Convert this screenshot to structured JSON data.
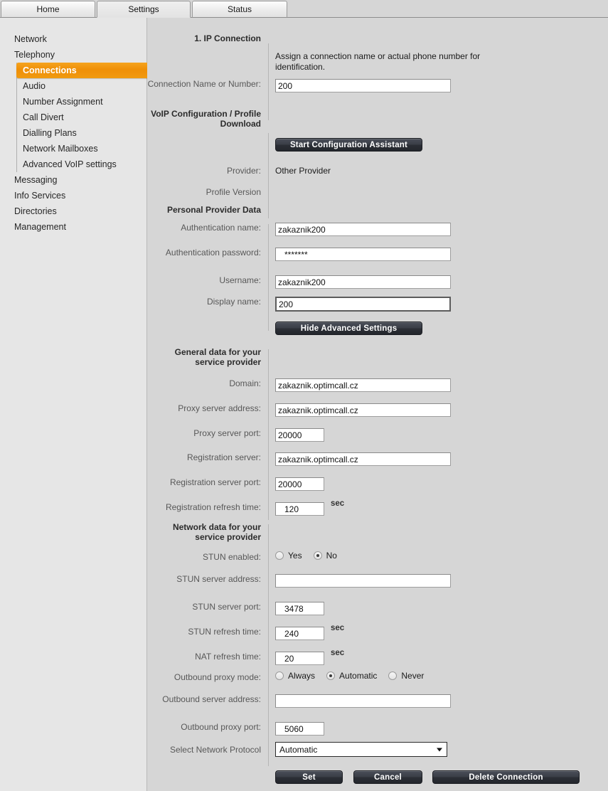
{
  "tabs": [
    {
      "label": "Home",
      "active": false
    },
    {
      "label": "Settings",
      "active": true
    },
    {
      "label": "Status",
      "active": false
    }
  ],
  "sidebar": {
    "items": [
      {
        "label": "Network"
      },
      {
        "label": "Telephony"
      },
      {
        "label": "Messaging"
      },
      {
        "label": "Info Services"
      },
      {
        "label": "Directories"
      },
      {
        "label": "Management"
      }
    ],
    "telephony_sub": [
      {
        "label": "Connections",
        "selected": true
      },
      {
        "label": "Audio",
        "selected": false
      },
      {
        "label": "Number Assignment",
        "selected": false
      },
      {
        "label": "Call Divert",
        "selected": false
      },
      {
        "label": "Dialling Plans",
        "selected": false
      },
      {
        "label": "Network Mailboxes",
        "selected": false
      },
      {
        "label": "Advanced VoIP settings",
        "selected": false
      }
    ]
  },
  "main": {
    "section_title": "1. IP Connection",
    "help_text": "Assign a connection name or actual phone number for identification.",
    "connection_name_label": "Connection Name or Number:",
    "connection_name_value": "200",
    "voip_config_label": "VoIP Configuration / Profile Download",
    "start_assistant_button": "Start Configuration Assistant",
    "provider_label": "Provider:",
    "provider_value": "Other Provider",
    "profile_version_label": "Profile Version",
    "profile_version_value": "",
    "personal_provider_data_label": "Personal Provider Data",
    "auth_name_label": "Authentication name:",
    "auth_name_value": "zakaznik200",
    "auth_password_label": "Authentication password:",
    "auth_password_value": "*******",
    "username_label": "Username:",
    "username_value": "zakaznik200",
    "display_name_label": "Display name:",
    "display_name_value": "200",
    "hide_advanced_button": "Hide Advanced Settings",
    "general_data_label": "General data for your service provider",
    "domain_label": "Domain:",
    "domain_value": "zakaznik.optimcall.cz",
    "proxy_server_address_label": "Proxy server address:",
    "proxy_server_address_value": "zakaznik.optimcall.cz",
    "proxy_server_port_label": "Proxy server port:",
    "proxy_server_port_value": "20000",
    "registration_server_label": "Registration server:",
    "registration_server_value": "zakaznik.optimcall.cz",
    "registration_server_port_label": "Registration server port:",
    "registration_server_port_value": "20000",
    "registration_refresh_label": "Registration refresh time:",
    "registration_refresh_value": "120",
    "registration_refresh_unit": "sec",
    "network_data_label": "Network data for your service provider",
    "stun_enabled_label": "STUN enabled:",
    "stun_enabled_options": [
      {
        "label": "Yes",
        "checked": false
      },
      {
        "label": "No",
        "checked": true
      }
    ],
    "stun_server_address_label": "STUN server address:",
    "stun_server_address_value": "",
    "stun_server_port_label": "STUN server port:",
    "stun_server_port_value": "3478",
    "stun_refresh_label": "STUN refresh time:",
    "stun_refresh_value": "240",
    "stun_refresh_unit": "sec",
    "nat_refresh_label": "NAT refresh time:",
    "nat_refresh_value": "20",
    "nat_refresh_unit": "sec",
    "outbound_proxy_mode_label": "Outbound proxy mode:",
    "outbound_proxy_mode_options": [
      {
        "label": "Always",
        "checked": false
      },
      {
        "label": "Automatic",
        "checked": true
      },
      {
        "label": "Never",
        "checked": false
      }
    ],
    "outbound_server_address_label": "Outbound server address:",
    "outbound_server_address_value": "",
    "outbound_proxy_port_label": "Outbound proxy port:",
    "outbound_proxy_port_value": "5060",
    "select_network_protocol_label": "Select Network Protocol",
    "select_network_protocol_value": "Automatic",
    "set_button": "Set",
    "cancel_button": "Cancel",
    "delete_button": "Delete Connection"
  },
  "colors": {
    "accent_orange": "#ef8f07",
    "page_background": "#d6d6d6",
    "sidebar_background": "#e6e6e6",
    "button_dark": "#2c2f36"
  }
}
